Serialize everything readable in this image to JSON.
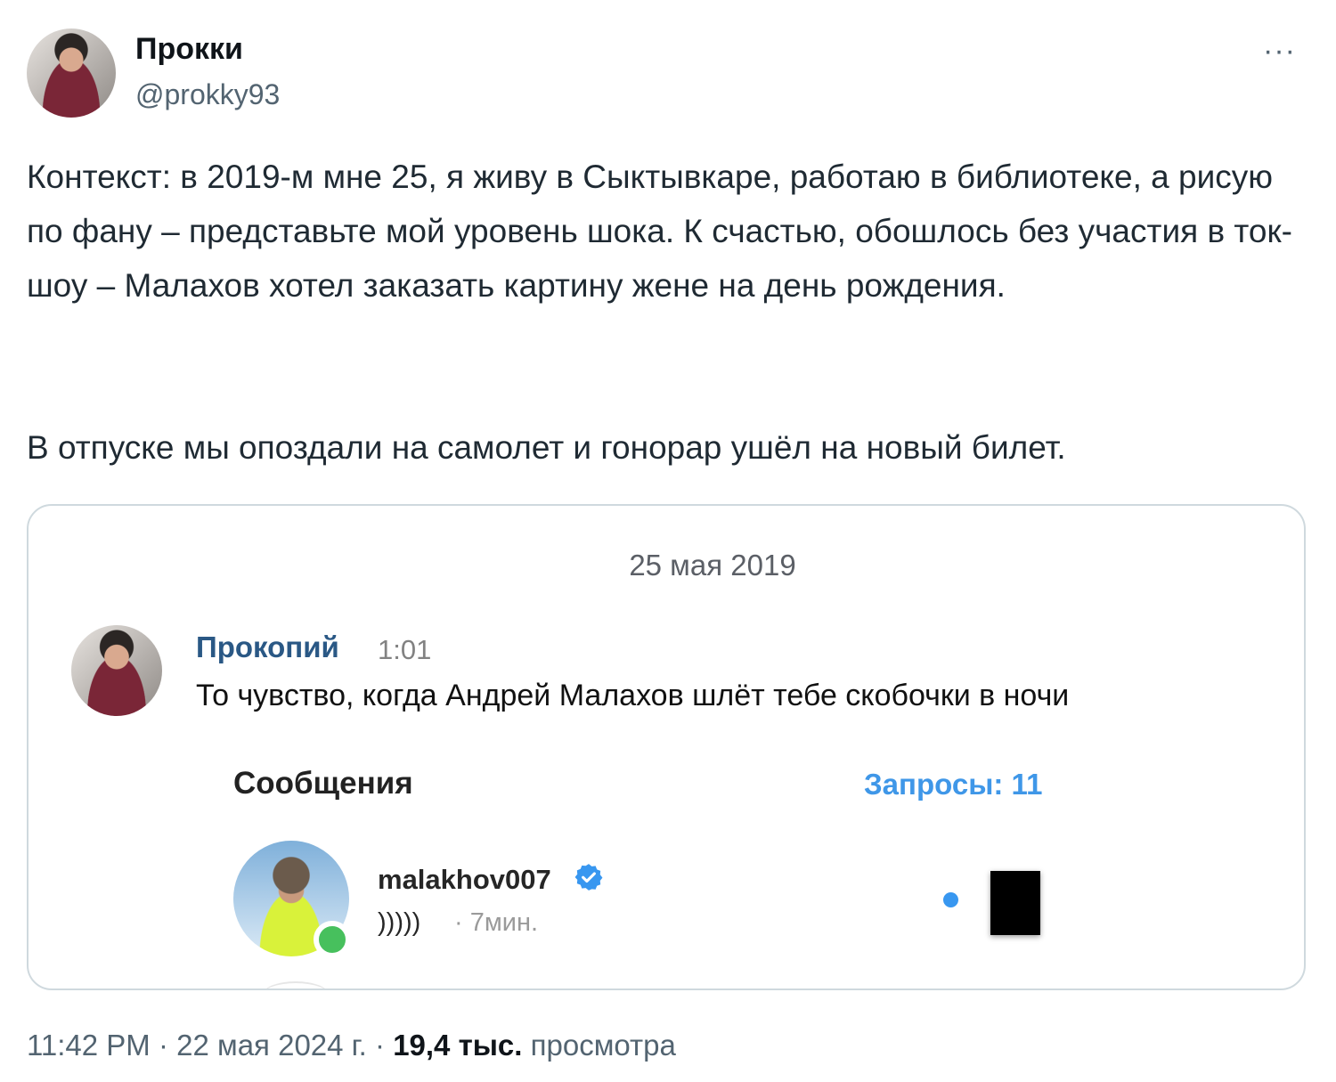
{
  "author": {
    "name": "Прокки",
    "handle": "@prokky93",
    "avatar_icon": "user-avatar",
    "more_icon": "···"
  },
  "tweet": {
    "paragraph1": "Контекст: в 2019-м мне 25, я живу в Сыктывкаре, работаю в библиотеке, а рисую по фану – представьте мой уровень шока. К счастью, обошлось без участия в ток-шоу – Малахов хотел заказать картину жене на день рождения.",
    "paragraph2": "В отпуске мы опоздали на самолет и гонорар ушёл на новый билет."
  },
  "media": {
    "date": "25 мая 2019",
    "message": {
      "sender": "Прокопий",
      "time": "1:01",
      "text": "То чувство, когда Андрей Малахов шлёт тебе скобочки в ночи"
    },
    "inbox": {
      "title": "Сообщения",
      "requests": "Запросы: 11",
      "contact": {
        "username": "malakhov007",
        "verified": true,
        "last_message": ")))))",
        "time": "· 7мин.",
        "unread": true,
        "online": true
      }
    }
  },
  "meta": {
    "time": "11:42 PM",
    "sep1": " · ",
    "date": "22 мая 2024 г.",
    "sep2": " · ",
    "views": "19,4 тыс.",
    "views_label": " просмотра"
  },
  "colors": {
    "link_blue": "#2a5885",
    "requests_blue": "#3f97e8",
    "unread_dot": "#3897f0",
    "verified": "#3897f0",
    "online": "#47c05d"
  }
}
